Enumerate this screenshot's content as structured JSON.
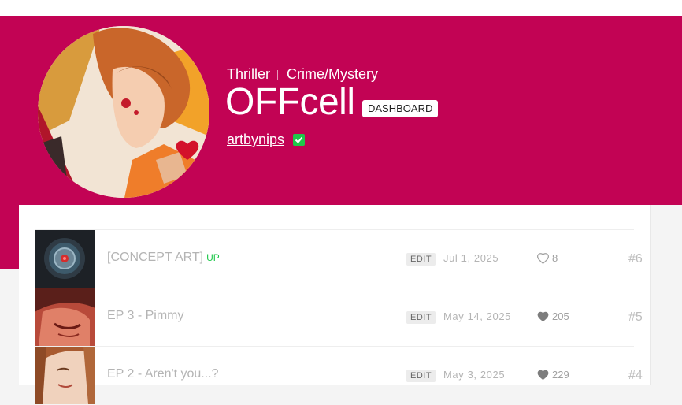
{
  "header": {
    "genres": [
      "Thriller",
      "Crime/Mystery"
    ],
    "title": "OFFcell",
    "dashboard_label": "DASHBOARD",
    "author": "artbynips"
  },
  "colors": {
    "banner": "#c20354",
    "up_badge": "#1ec84a",
    "verified": "#1ec84a"
  },
  "episodes": [
    {
      "title": "[CONCEPT ART]",
      "badge": "UP",
      "edit_label": "EDIT",
      "date": "Jul 1, 2025",
      "likes": "8",
      "liked": false,
      "number": "#6"
    },
    {
      "title": "EP 3 - Pimmy",
      "edit_label": "EDIT",
      "date": "May 14, 2025",
      "likes": "205",
      "liked": true,
      "number": "#5"
    },
    {
      "title": "EP 2 - Aren't you...?",
      "edit_label": "EDIT",
      "date": "May 3, 2025",
      "likes": "229",
      "liked": true,
      "number": "#4"
    }
  ]
}
